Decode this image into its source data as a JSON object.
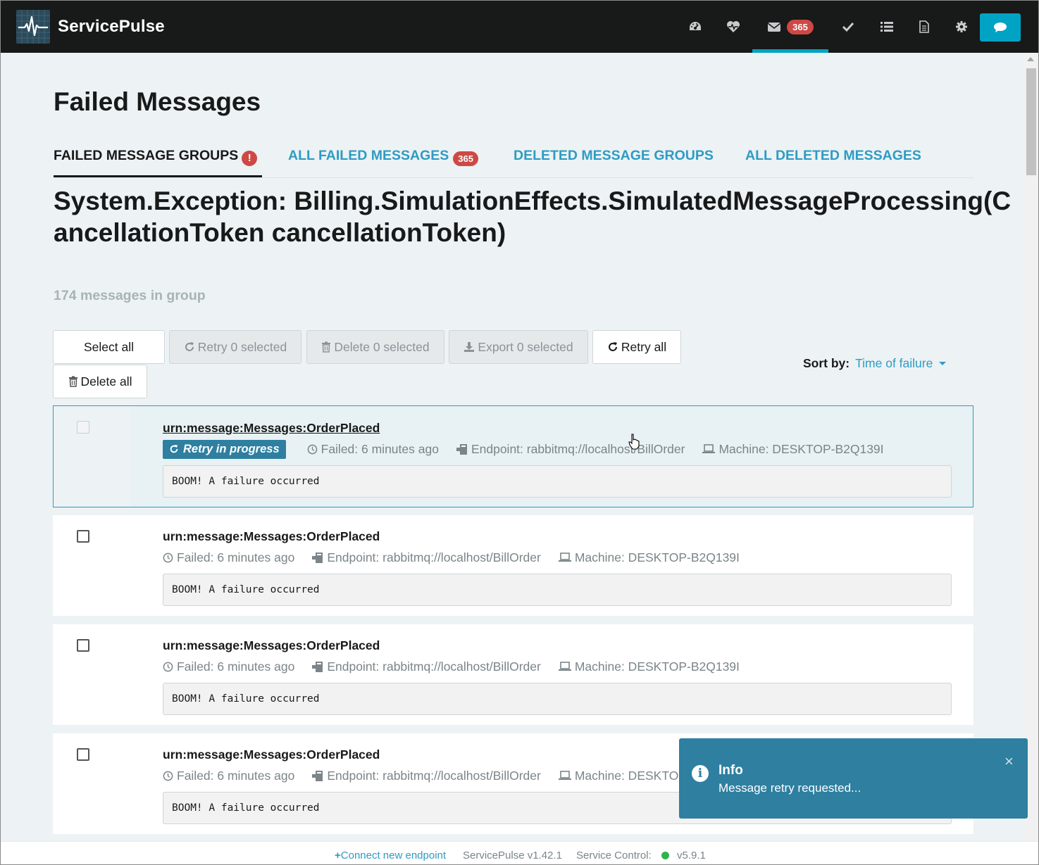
{
  "brand": {
    "name": "ServicePulse"
  },
  "nav": {
    "items": [
      {
        "name": "dashboard",
        "icon": "dashboard-icon"
      },
      {
        "name": "heartbeats",
        "icon": "heartbeat-icon"
      },
      {
        "name": "failed-messages",
        "icon": "envelope-icon",
        "badge": "365",
        "active": true
      },
      {
        "name": "custom-checks",
        "icon": "check-icon"
      },
      {
        "name": "events",
        "icon": "list-icon"
      },
      {
        "name": "configuration",
        "icon": "document-icon"
      },
      {
        "name": "settings",
        "icon": "gear-icon"
      }
    ],
    "chat_icon": "chat-icon"
  },
  "page": {
    "title": "Failed Messages",
    "tabs": [
      {
        "label": "FAILED MESSAGE GROUPS",
        "active": true,
        "alert": "!"
      },
      {
        "label": "ALL FAILED MESSAGES",
        "badge": "365"
      },
      {
        "label": "DELETED MESSAGE GROUPS"
      },
      {
        "label": "ALL DELETED MESSAGES"
      }
    ],
    "group_title": "System.Exception: Billing.SimulationEffects.SimulatedMessageProcessing(CancellationToken cancellationToken)",
    "group_count": "174 messages in group"
  },
  "actions": {
    "select_all": "Select all",
    "retry_selected": "Retry 0 selected",
    "delete_selected": "Delete 0 selected",
    "export_selected": "Export 0 selected",
    "retry_all": "Retry all",
    "delete_all": "Delete all"
  },
  "sort": {
    "label": "Sort by:",
    "value": "Time of failure"
  },
  "messages": [
    {
      "type": "urn:message:Messages:OrderPlaced",
      "status": "Retry in progress",
      "failed": "Failed: 6 minutes ago",
      "endpoint": "Endpoint: rabbitmq://localhost/BillOrder",
      "machine": "Machine: DESKTOP-B2Q139I",
      "exception": "BOOM! A failure occurred"
    },
    {
      "type": "urn:message:Messages:OrderPlaced",
      "failed": "Failed: 6 minutes ago",
      "endpoint": "Endpoint: rabbitmq://localhost/BillOrder",
      "machine": "Machine: DESKTOP-B2Q139I",
      "exception": "BOOM! A failure occurred"
    },
    {
      "type": "urn:message:Messages:OrderPlaced",
      "failed": "Failed: 6 minutes ago",
      "endpoint": "Endpoint: rabbitmq://localhost/BillOrder",
      "machine": "Machine: DESKTOP-B2Q139I",
      "exception": "BOOM! A failure occurred"
    },
    {
      "type": "urn:message:Messages:OrderPlaced",
      "failed": "Failed: 6 minutes ago",
      "endpoint": "Endpoint: rabbitmq://localhost/BillOrder",
      "machine": "Machine: DESKTOP-B2Q139I",
      "exception": "BOOM! A failure occurred"
    }
  ],
  "toast": {
    "title": "Info",
    "message": "Message retry requested...",
    "close": "×"
  },
  "footer": {
    "connect": "Connect new endpoint",
    "version": "ServicePulse v1.42.1",
    "service_control_label": "Service Control:",
    "service_control_version": "v5.9.1"
  },
  "colors": {
    "accent": "#2e9bc4",
    "navbar": "#181919",
    "badge": "#ce4844",
    "retry_label": "#2e7fa0",
    "status_ok": "#2fb34b"
  }
}
